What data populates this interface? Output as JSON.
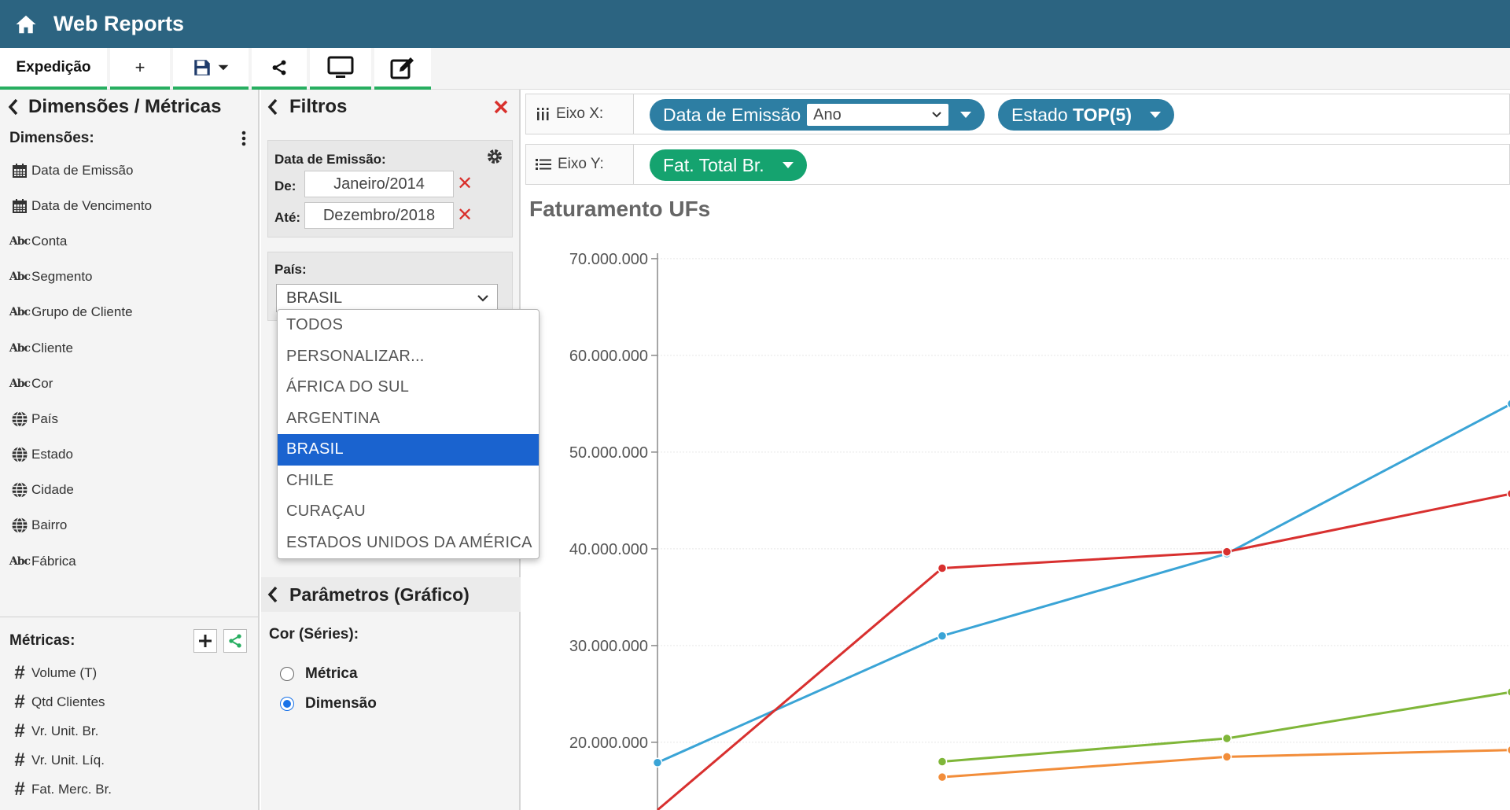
{
  "app": {
    "title": "Web Reports",
    "icon": "home-icon"
  },
  "tabs": {
    "main_label": "Expedição",
    "plus_label": "+"
  },
  "dimensions_panel": {
    "title": "Dimensões / Métricas",
    "dimensions_label": "Dimensões:",
    "dimensions": [
      {
        "label": "Data de Emissão",
        "icon": "calendar-icon"
      },
      {
        "label": "Data de Vencimento",
        "icon": "calendar-icon"
      },
      {
        "label": "Conta",
        "icon": "abc-icon"
      },
      {
        "label": "Segmento",
        "icon": "abc-icon"
      },
      {
        "label": "Grupo de Cliente",
        "icon": "abc-icon"
      },
      {
        "label": "Cliente",
        "icon": "abc-icon"
      },
      {
        "label": "Cor",
        "icon": "abc-icon"
      },
      {
        "label": "País",
        "icon": "globe-icon"
      },
      {
        "label": "Estado",
        "icon": "globe-icon"
      },
      {
        "label": "Cidade",
        "icon": "globe-icon"
      },
      {
        "label": "Bairro",
        "icon": "globe-icon"
      },
      {
        "label": "Fábrica",
        "icon": "abc-icon"
      }
    ],
    "metrics_label": "Métricas:",
    "metrics": [
      {
        "label": "Volume (T)",
        "icon": "hash-icon"
      },
      {
        "label": "Qtd Clientes",
        "icon": "hash-icon"
      },
      {
        "label": "Vr. Unit. Br.",
        "icon": "hash-icon"
      },
      {
        "label": "Vr. Unit. Líq.",
        "icon": "hash-icon"
      },
      {
        "label": "Fat. Merc. Br.",
        "icon": "hash-icon"
      }
    ]
  },
  "filters_panel": {
    "title": "Filtros",
    "date_filter": {
      "label": "Data de Emissão:",
      "from_label": "De:",
      "from_value": "Janeiro/2014",
      "to_label": "Até:",
      "to_value": "Dezembro/2018"
    },
    "country_filter": {
      "label": "País:",
      "selected": "BRASIL",
      "options": [
        "TODOS",
        "PERSONALIZAR...",
        "ÁFRICA DO SUL",
        "ARGENTINA",
        "BRASIL",
        "CHILE",
        "CURAÇAU",
        "ESTADOS UNIDOS DA AMÉRICA"
      ]
    }
  },
  "params_panel": {
    "title": "Parâmetros (Gráfico)",
    "color_label": "Cor (Séries):",
    "options": [
      {
        "label": "Métrica",
        "checked": false
      },
      {
        "label": "Dimensão",
        "checked": true
      }
    ]
  },
  "axes": {
    "x_label": "Eixo X:",
    "y_label": "Eixo Y:",
    "x_pills": [
      {
        "label": "Data de Emissão",
        "select_value": "Ano"
      },
      {
        "label_prefix": "Estado",
        "label_bold": "TOP(5)"
      }
    ],
    "y_pills": [
      {
        "label": "Fat. Total Br."
      }
    ]
  },
  "colors": {
    "header": "#2c6481",
    "pill_blue": "#2d7ea3",
    "pill_green": "#15a36f",
    "selected_option": "#1a63cf",
    "close_red": "#d9302c"
  },
  "chart_data": {
    "type": "line",
    "title": "Faturamento UFs",
    "ylim": [
      13000000,
      73000000
    ],
    "yticks": [
      "20.000.000",
      "30.000.000",
      "40.000.000",
      "50.000.000",
      "60.000.000",
      "70.000.000"
    ],
    "ytick_values": [
      20000000,
      30000000,
      40000000,
      50000000,
      60000000,
      70000000
    ],
    "grid": true,
    "x": [
      0,
      1,
      2,
      3
    ],
    "series": [
      {
        "color": "#3aa4d6",
        "values": [
          17900000,
          31000000,
          39500000,
          55000000
        ]
      },
      {
        "color": "#d8302f",
        "values": [
          13000000,
          38000000,
          39700000,
          45700000
        ]
      },
      {
        "color": "#7fb639",
        "values": [
          null,
          18000000,
          20400000,
          25200000
        ]
      },
      {
        "color": "#f28d3a",
        "values": [
          null,
          16400000,
          18500000,
          19200000
        ]
      }
    ]
  }
}
